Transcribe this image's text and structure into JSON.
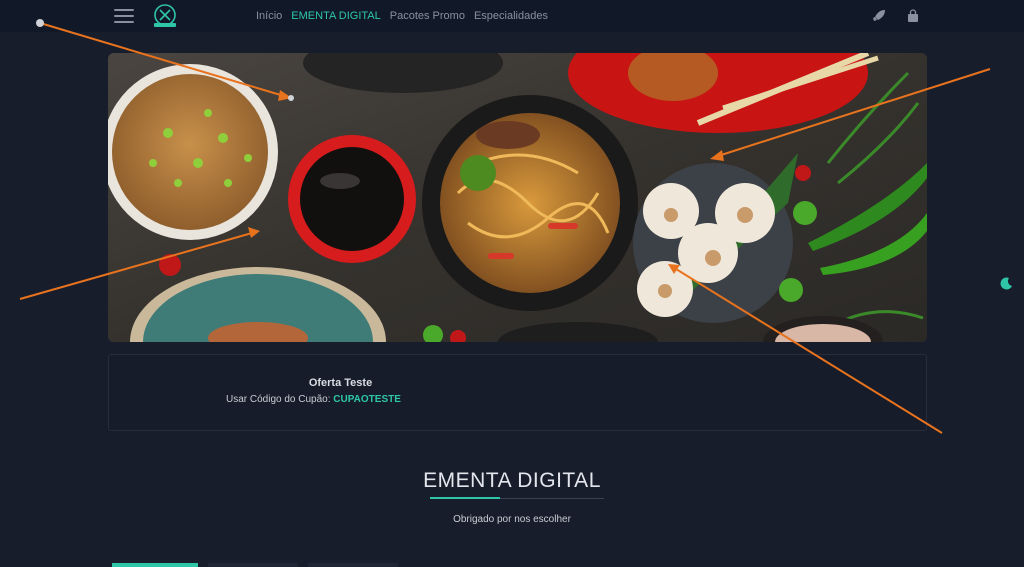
{
  "nav": {
    "menu_icon": "hamburger-menu-icon",
    "logo_icon": "restaurant-logo-icon",
    "links": [
      {
        "label": "Início",
        "active": false
      },
      {
        "label": "EMENTA DIGITAL",
        "active": true
      },
      {
        "label": "Pacotes Promo",
        "active": false
      },
      {
        "label": "Especialidades",
        "active": false
      }
    ],
    "right_icons": [
      "rocket-icon",
      "shopping-bag-icon"
    ]
  },
  "hero": {
    "image": "asian-food-banner"
  },
  "offer": {
    "title": "Oferta Teste",
    "code_label": "Usar Código do Cupão:",
    "code": "CUPAOTESTE"
  },
  "section": {
    "title": "EMENTA DIGITAL",
    "subtitle": "Obrigado por nos escolher"
  },
  "side_toggle": {
    "icon": "moon-icon"
  },
  "colors": {
    "background": "#171d2b",
    "navbar": "#111827",
    "accent": "#2fc6a8",
    "annotation_arrow": "#e8731e"
  }
}
